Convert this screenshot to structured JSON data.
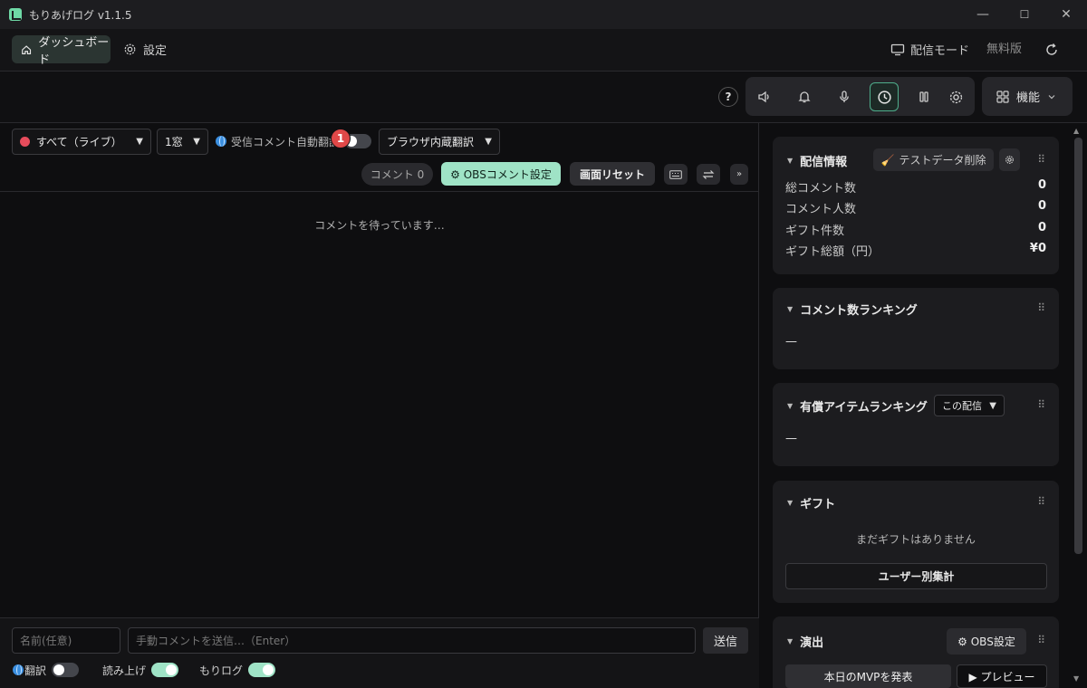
{
  "window": {
    "title": "もりあげログ  v1.1.5",
    "controls": {
      "minimize": "—",
      "maximize": "☐",
      "close": "✕"
    }
  },
  "nav": {
    "dashboard_label": "ダッシュボード",
    "settings_label": "設定",
    "stream_mode_label": "配信モード",
    "free_version_label": "無料版"
  },
  "toolbar": {
    "help_label": "?",
    "features_label": "機能",
    "active_tool": "clock-icon"
  },
  "comments": {
    "filter_select": "すべて（ライブ）",
    "window_select": "1窓",
    "auto_translate_label": "受信コメント自動翻訳",
    "auto_translate_on": false,
    "translation_engine": "ブラウザ内蔵翻訳",
    "notification_badge": "1",
    "comment_count_label": "コメント 0",
    "obs_comment_settings": "⚙ OBSコメント設定",
    "screen_reset": "画面リセット",
    "waiting_text": "コメントを待っています…",
    "name_placeholder": "名前(任意)",
    "manual_comment_placeholder": "手動コメントを送信…（Enter）",
    "send_label": "送信",
    "translate_toggle_label": "翻訳",
    "translate_toggle_on": false,
    "readout_toggle_label": "読み上げ",
    "readout_toggle_on": true,
    "morilog_toggle_label": "もりログ",
    "morilog_toggle_on": true
  },
  "stream_info": {
    "title": "配信情報",
    "clear_test_data_label": "テストデータ削除",
    "rows": [
      {
        "label": "総コメント数",
        "value": "0"
      },
      {
        "label": "コメント人数",
        "value": "0"
      },
      {
        "label": "ギフト件数",
        "value": "0"
      },
      {
        "label": "ギフト総額（円）",
        "value": "¥0"
      }
    ]
  },
  "comment_ranking": {
    "title": "コメント数ランキング",
    "empty": "—"
  },
  "paid_item_ranking": {
    "title": "有償アイテムランキング",
    "scope_select": "この配信",
    "empty": "—"
  },
  "gift": {
    "title": "ギフト",
    "empty_text": "まだギフトはありません",
    "user_summary_label": "ユーザー別集計"
  },
  "effects": {
    "title": "演出",
    "obs_settings_label": "⚙ OBS設定",
    "announce_mvp_label": "本日のMVPを発表",
    "preview_label": "▶ プレビュー"
  },
  "colors": {
    "accent": "#9fe3c6",
    "badge": "#e04848",
    "live_dot": "#e74c5c"
  }
}
